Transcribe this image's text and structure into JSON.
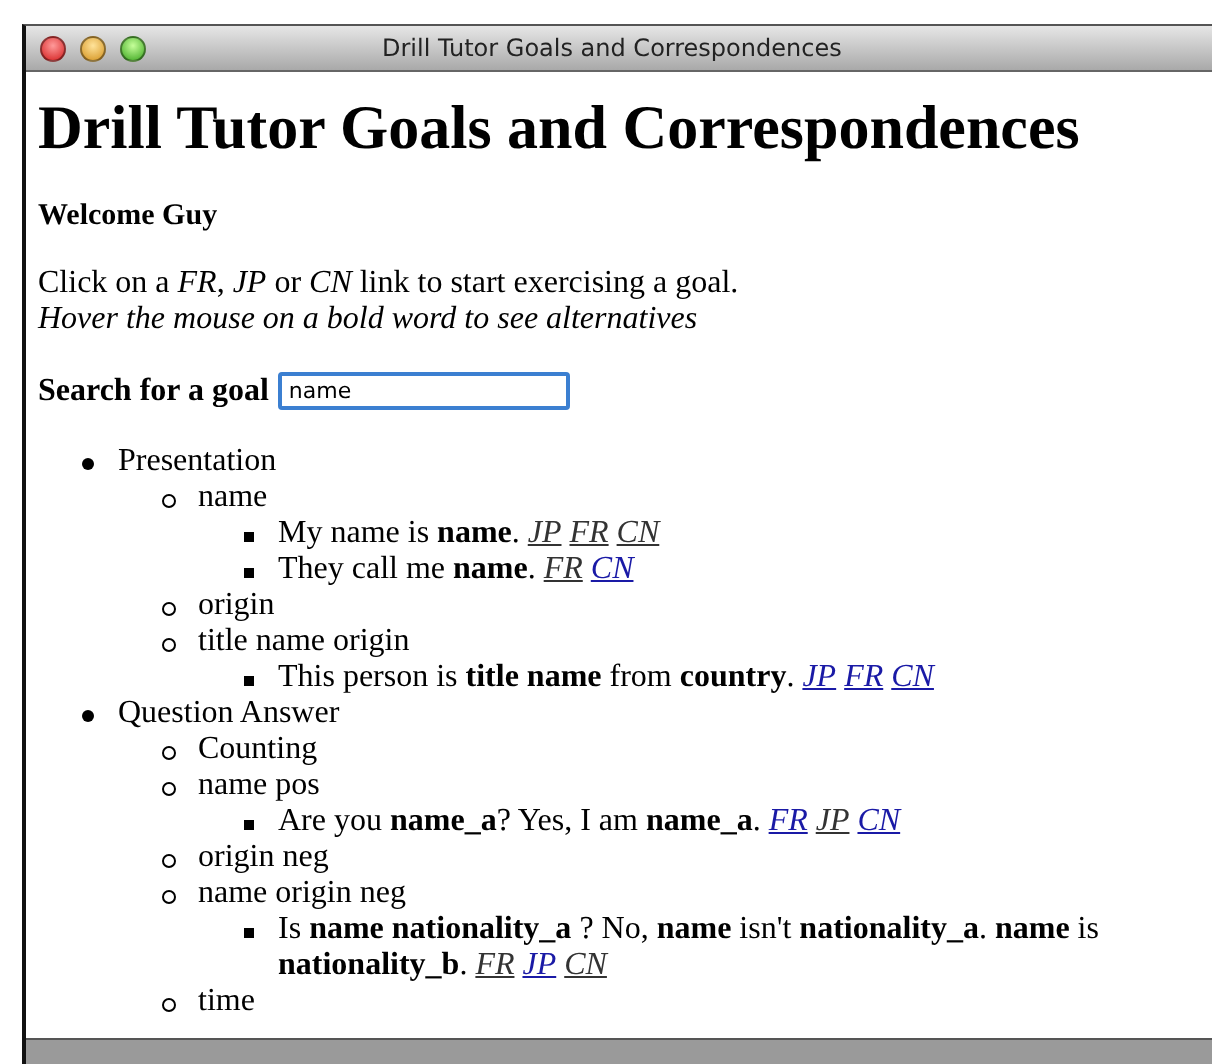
{
  "window": {
    "title": "Drill Tutor Goals and Correspondences"
  },
  "heading": "Drill Tutor Goals and Correspondences",
  "welcome": "Welcome Guy",
  "instructions": "Click on a *FR*, *JP* or *CN* link to start exercising a goal.",
  "hint": "Hover the mouse on a bold word to see alternatives",
  "search": {
    "label": "Search for a goal",
    "value": "name"
  },
  "goals": [
    {
      "label": "Presentation",
      "children": [
        {
          "label": "name",
          "sentences": [
            {
              "text": "My name is **name**.",
              "links": [
                {
                  "label": "JP",
                  "visited": true
                },
                {
                  "label": "FR",
                  "visited": true
                },
                {
                  "label": "CN",
                  "visited": true
                }
              ]
            },
            {
              "text": "They call me **name**.",
              "links": [
                {
                  "label": "FR",
                  "visited": true
                },
                {
                  "label": "CN",
                  "visited": false
                }
              ]
            }
          ]
        },
        {
          "label": "origin"
        },
        {
          "label": "title name origin",
          "sentences": [
            {
              "text": "This person is **title name** from **country**.",
              "links": [
                {
                  "label": "JP",
                  "visited": false
                },
                {
                  "label": "FR",
                  "visited": false
                },
                {
                  "label": "CN",
                  "visited": false
                }
              ]
            }
          ]
        }
      ]
    },
    {
      "label": "Question Answer",
      "children": [
        {
          "label": "Counting"
        },
        {
          "label": "name pos",
          "sentences": [
            {
              "text": "Are you **name_a**? Yes, I am **name_a**.",
              "links": [
                {
                  "label": "FR",
                  "visited": false
                },
                {
                  "label": "JP",
                  "visited": true
                },
                {
                  "label": "CN",
                  "visited": false
                }
              ]
            }
          ]
        },
        {
          "label": "origin neg"
        },
        {
          "label": "name origin neg",
          "sentences": [
            {
              "text": "Is **name nationality_a** ? No, **name** isn't **nationality_a**. **name** is **nationality_b**.",
              "links": [
                {
                  "label": "FR",
                  "visited": true
                },
                {
                  "label": "JP",
                  "visited": false
                },
                {
                  "label": "CN",
                  "visited": true
                }
              ]
            }
          ]
        },
        {
          "label": "time"
        }
      ]
    }
  ]
}
